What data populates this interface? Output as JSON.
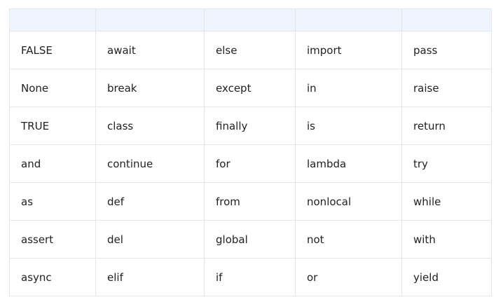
{
  "table": {
    "headers": [
      "",
      "",
      "",
      "",
      ""
    ],
    "rows": [
      [
        "FALSE",
        "await",
        "else",
        "import",
        "pass"
      ],
      [
        "None",
        "break",
        "except",
        "in",
        "raise"
      ],
      [
        "TRUE",
        "class",
        "finally",
        "is",
        "return"
      ],
      [
        "and",
        "continue",
        "for",
        "lambda",
        "try"
      ],
      [
        "as",
        "def",
        "from",
        "nonlocal",
        "while"
      ],
      [
        "assert",
        "del",
        "global",
        "not",
        "with"
      ],
      [
        "async",
        "elif",
        "if",
        "or",
        "yield"
      ]
    ]
  },
  "colors": {
    "header_background": "#eff4ff",
    "border": "#e3e6ea",
    "text": "#222222"
  }
}
